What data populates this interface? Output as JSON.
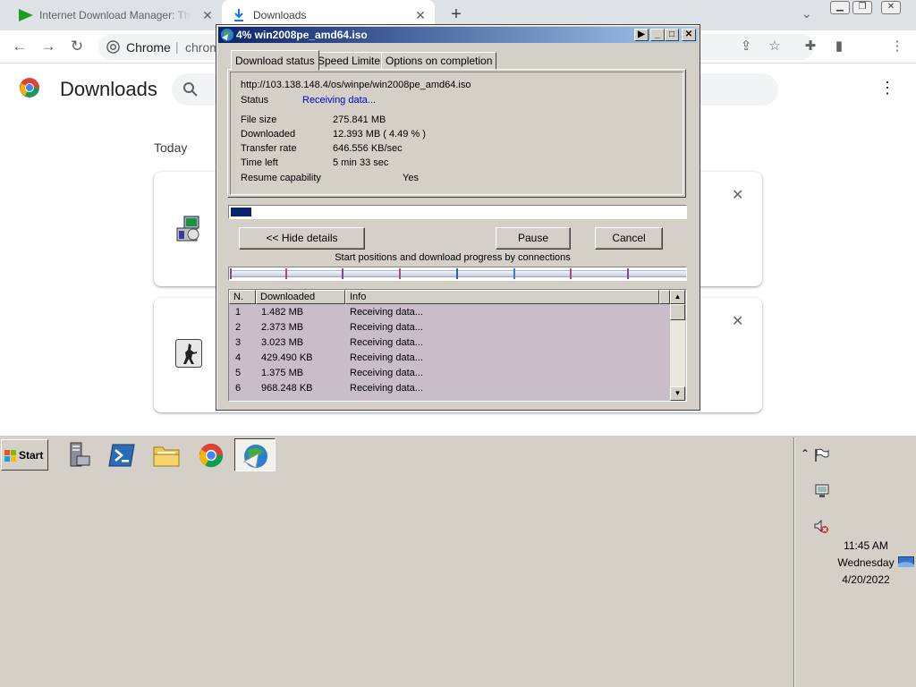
{
  "chrome": {
    "tabs": [
      {
        "title": "Internet Download Manager: The fastest download accelerator"
      },
      {
        "title": "Downloads"
      }
    ],
    "omnibox": {
      "site": "Chrome",
      "url": "chrome://downloads"
    },
    "page_title": "Downloads",
    "section_today": "Today"
  },
  "idm": {
    "title": "4% win2008pe_amd64.iso",
    "tabs": [
      "Download status",
      "Speed Limiter",
      "Options on completion"
    ],
    "url": "http://103.138.148.4/os/winpe/win2008pe_amd64.iso",
    "status_label": "Status",
    "status_value": "Receiving data...",
    "fields": [
      {
        "label": "File size",
        "value": "275.841  MB"
      },
      {
        "label": "Downloaded",
        "value": "12.393  MB  ( 4.49 % )"
      },
      {
        "label": "Transfer rate",
        "value": "646.556  KB/sec"
      },
      {
        "label": "Time left",
        "value": "5 min 33 sec"
      }
    ],
    "resume_label": "Resume capability",
    "resume_value": "Yes",
    "progress_percent": 4.49,
    "buttons": {
      "hide": "<< Hide details",
      "pause": "Pause",
      "cancel": "Cancel"
    },
    "connections_label": "Start positions and download progress by connections",
    "columns": [
      "N.",
      "Downloaded",
      "Info"
    ],
    "connections": [
      {
        "n": "1",
        "downloaded": "1.482  MB",
        "info": "Receiving data..."
      },
      {
        "n": "2",
        "downloaded": "2.373  MB",
        "info": "Receiving data..."
      },
      {
        "n": "3",
        "downloaded": "3.023  MB",
        "info": "Receiving data..."
      },
      {
        "n": "4",
        "downloaded": "429.490  KB",
        "info": "Receiving data..."
      },
      {
        "n": "5",
        "downloaded": "1.375  MB",
        "info": "Receiving data..."
      },
      {
        "n": "6",
        "downloaded": "968.248  KB",
        "info": "Receiving data..."
      }
    ]
  },
  "taskbar": {
    "start_label": "Start",
    "clock": {
      "time": "11:45 AM",
      "day": "Wednesday",
      "date": "4/20/2022"
    }
  },
  "colors": {
    "titlebar": "#0a246a",
    "status_blue": "#0000cc",
    "list_bg": "#c9bdc9"
  }
}
